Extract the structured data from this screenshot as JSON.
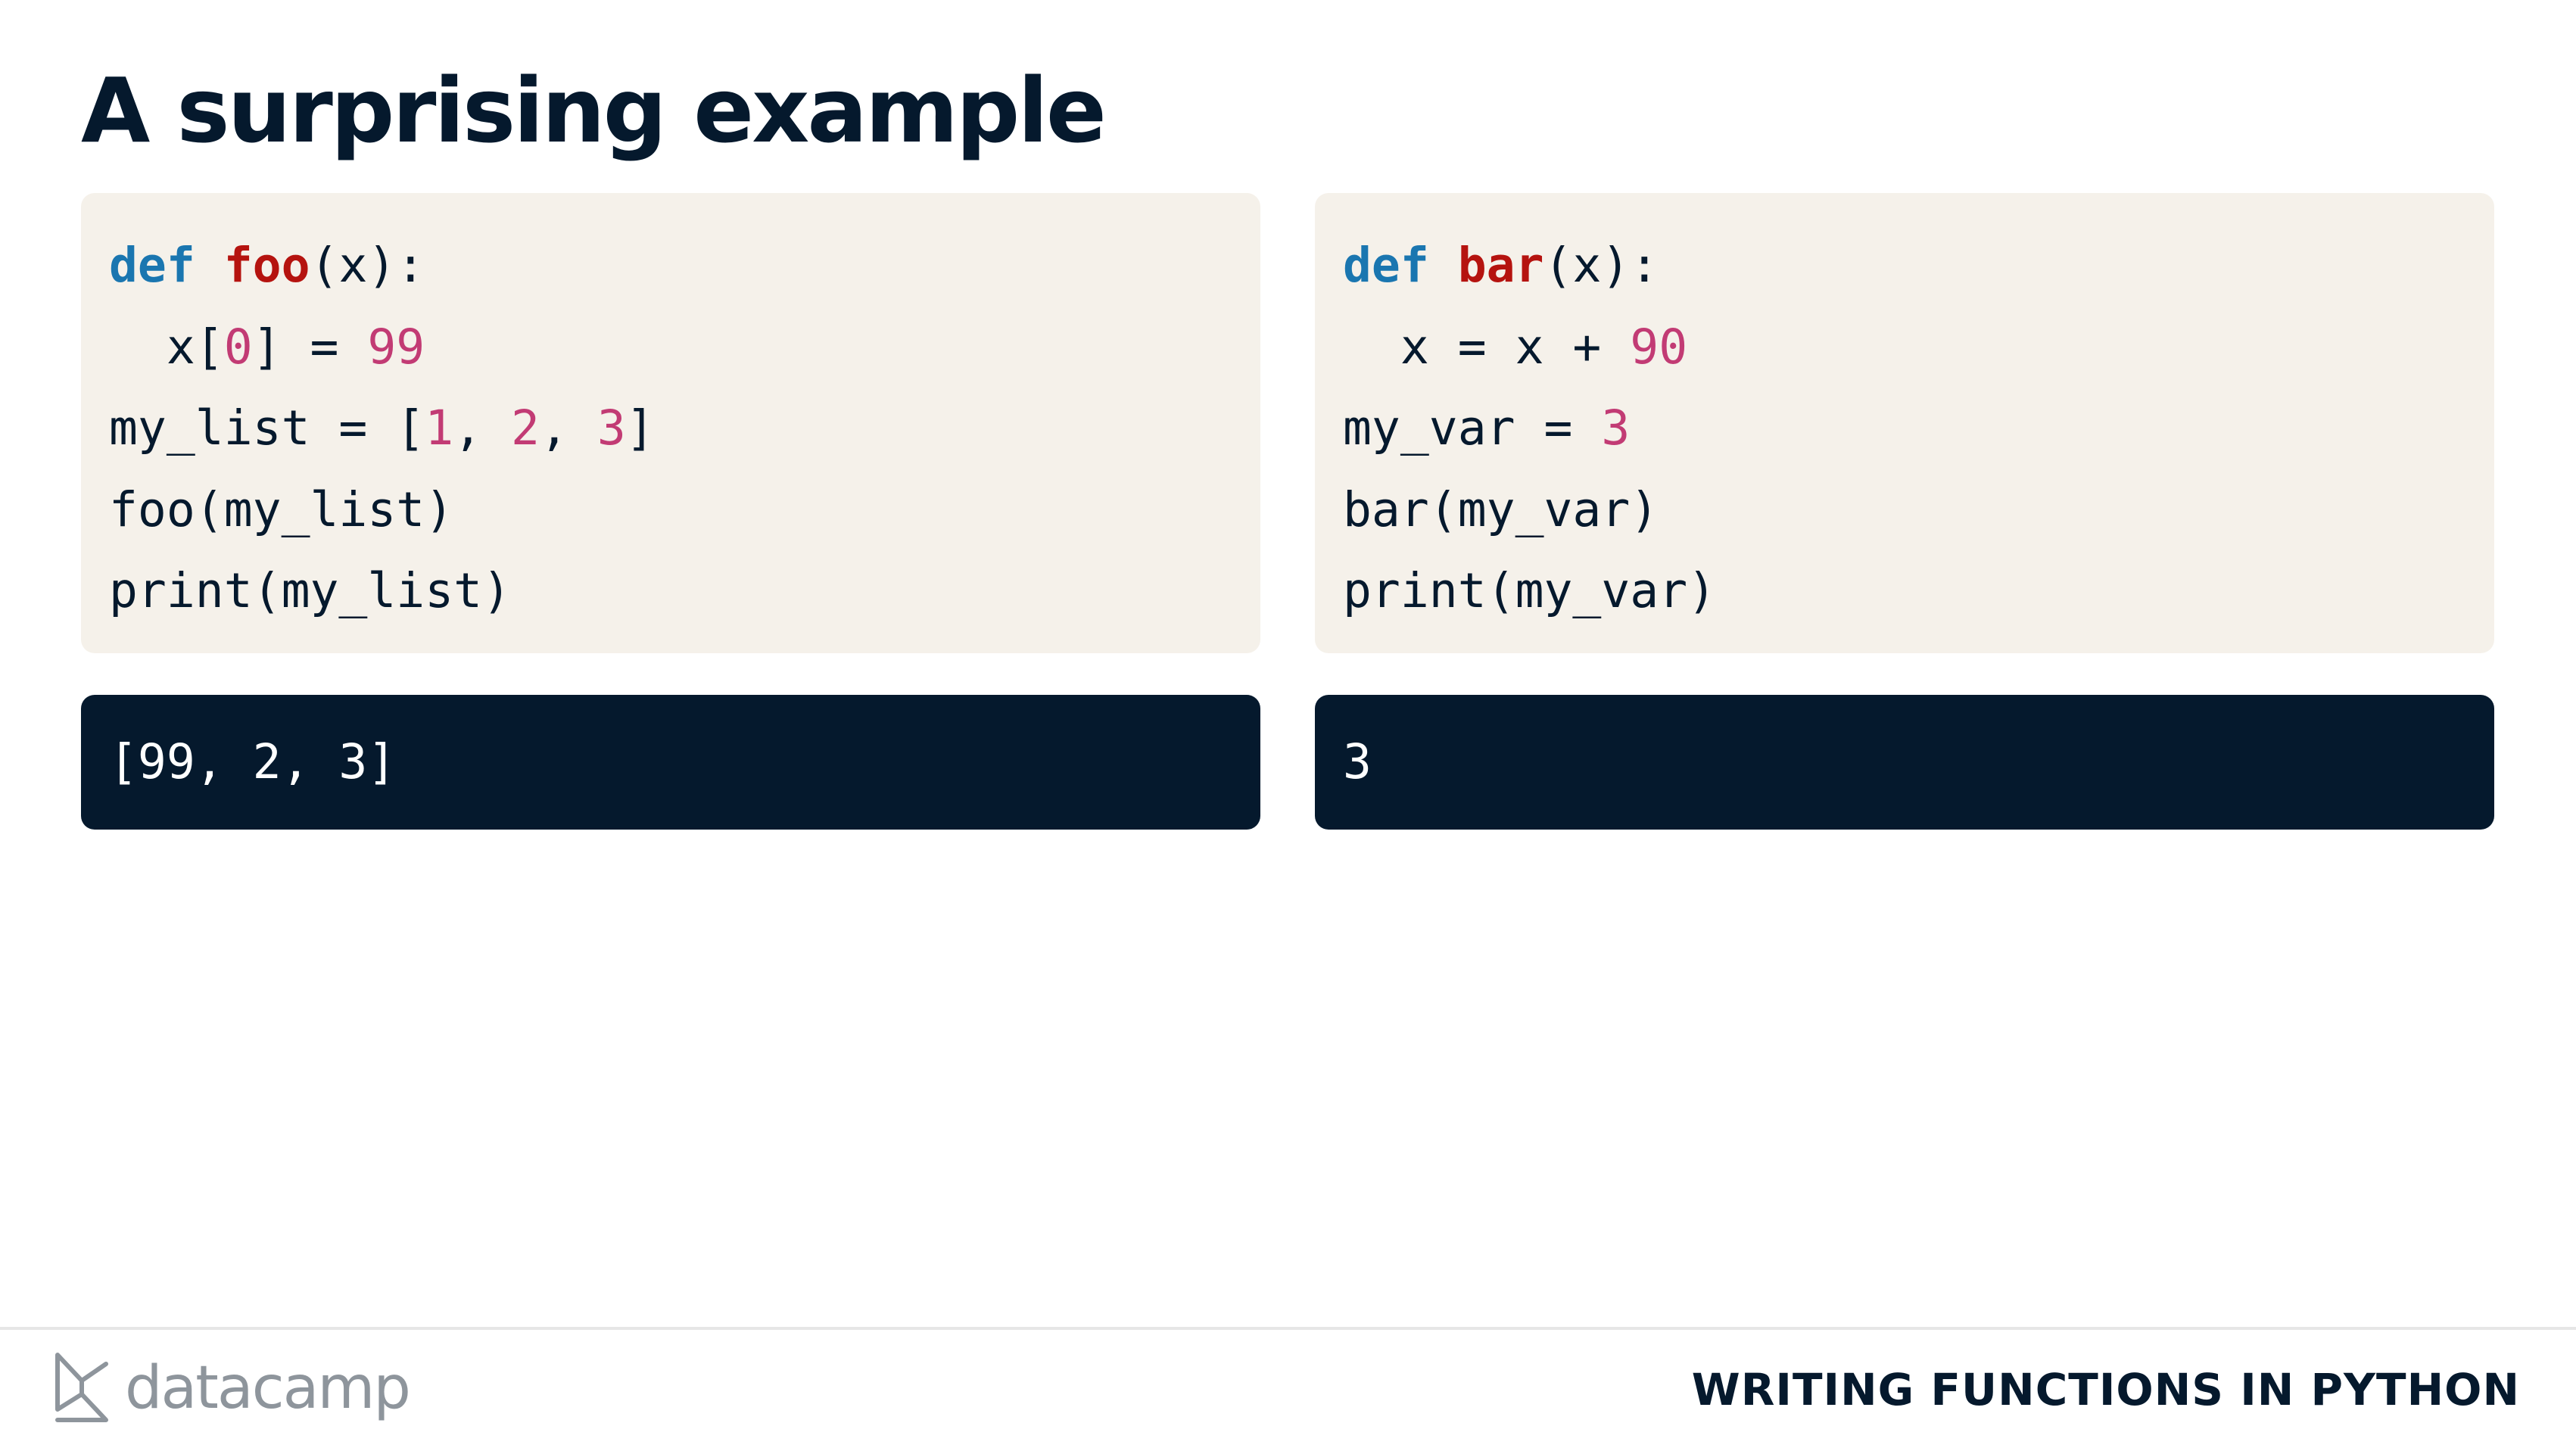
{
  "slide": {
    "title": "A surprising example"
  },
  "left_panel": {
    "code_lines": [
      [
        {
          "text": "def",
          "style": "kw"
        },
        {
          "text": " ",
          "style": "plain"
        },
        {
          "text": "foo",
          "style": "fn"
        },
        {
          "text": "(x):",
          "style": "plain"
        }
      ],
      [
        {
          "text": "  x[",
          "style": "plain"
        },
        {
          "text": "0",
          "style": "num"
        },
        {
          "text": "] = ",
          "style": "plain"
        },
        {
          "text": "99",
          "style": "num"
        }
      ],
      [
        {
          "text": "my_list = [",
          "style": "plain"
        },
        {
          "text": "1",
          "style": "num"
        },
        {
          "text": ", ",
          "style": "plain"
        },
        {
          "text": "2",
          "style": "num"
        },
        {
          "text": ", ",
          "style": "plain"
        },
        {
          "text": "3",
          "style": "num"
        },
        {
          "text": "]",
          "style": "plain"
        }
      ],
      [
        {
          "text": "foo(my_list)",
          "style": "plain"
        }
      ],
      [
        {
          "text": "print(my_list)",
          "style": "plain"
        }
      ]
    ],
    "output": "[99, 2, 3]"
  },
  "right_panel": {
    "code_lines": [
      [
        {
          "text": "def",
          "style": "kw"
        },
        {
          "text": " ",
          "style": "plain"
        },
        {
          "text": "bar",
          "style": "fn"
        },
        {
          "text": "(x):",
          "style": "plain"
        }
      ],
      [
        {
          "text": "  x = x + ",
          "style": "plain"
        },
        {
          "text": "90",
          "style": "num"
        }
      ],
      [
        {
          "text": "my_var = ",
          "style": "plain"
        },
        {
          "text": "3",
          "style": "num"
        }
      ],
      [
        {
          "text": "bar(my_var)",
          "style": "plain"
        }
      ],
      [
        {
          "text": "print(my_var)",
          "style": "plain"
        }
      ]
    ],
    "output": "3"
  },
  "footer": {
    "logo_text": "datacamp",
    "logo_icon": "datacamp-logo-icon",
    "course_title": "WRITING FUNCTIONS IN PYTHON"
  },
  "colors": {
    "navy": "#05192d",
    "code_background": "#f5f1ea",
    "keyword": "#1a76b0",
    "function_name": "#b5130f",
    "number": "#c23b74",
    "logo_gray": "#8e959c"
  }
}
